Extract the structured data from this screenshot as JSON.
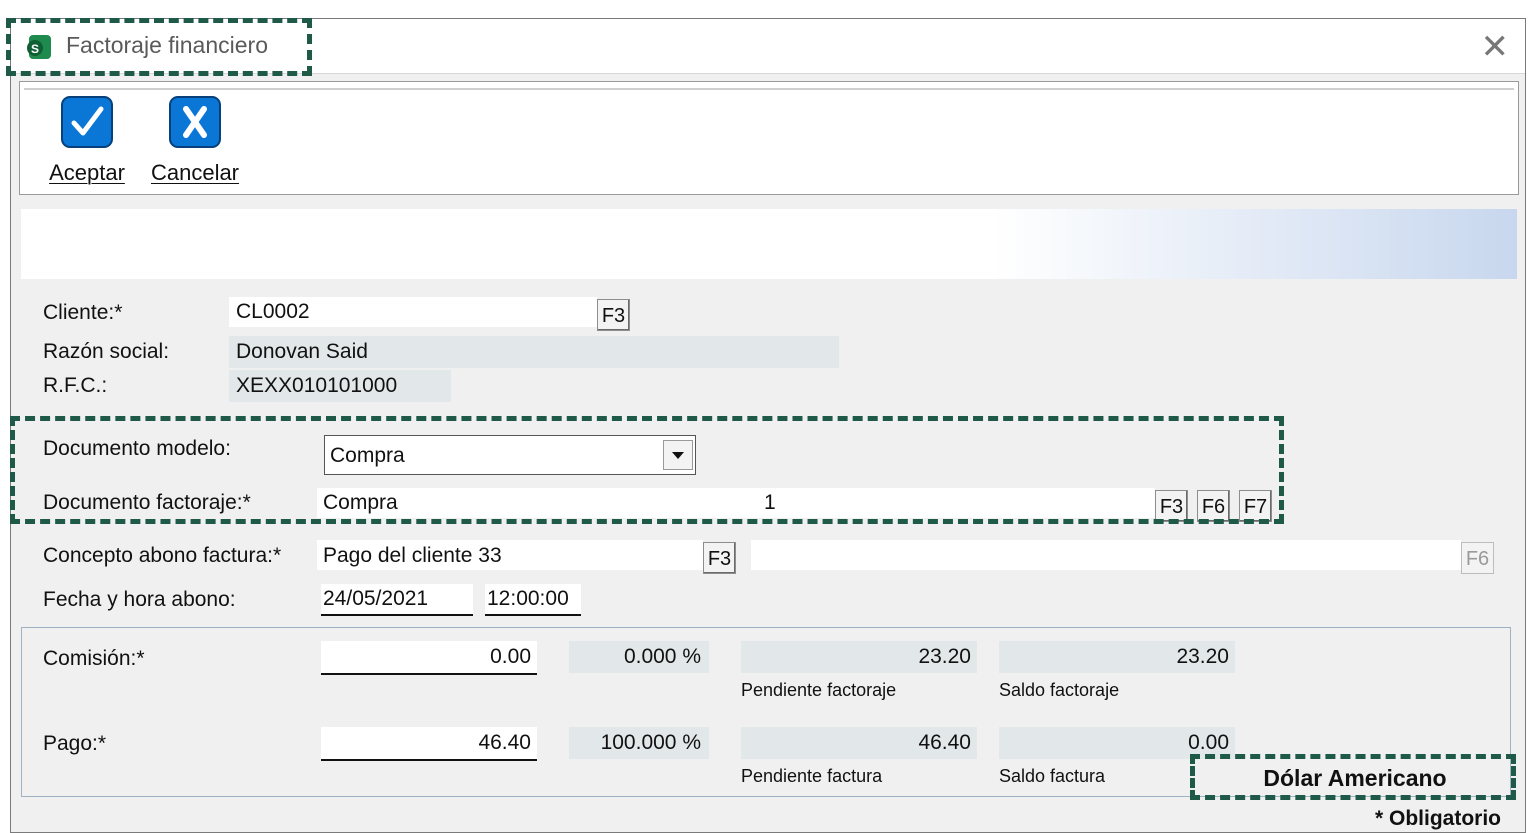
{
  "window": {
    "title": "Factoraje financiero"
  },
  "toolbar": {
    "accept_label": "Aceptar",
    "cancel_label": "Cancelar"
  },
  "form": {
    "cliente_label": "Cliente:*",
    "cliente_value": "CL0002",
    "razon_label": "Razón social:",
    "razon_value": "Donovan Said",
    "rfc_label": "R.F.C.:",
    "rfc_value": "XEXX010101000",
    "doc_modelo_label": "Documento modelo:",
    "doc_modelo_value": "Compra",
    "doc_factoraje_label": "Documento factoraje:*",
    "doc_factoraje_value": "Compra",
    "doc_factoraje_number": "1",
    "concepto_label": "Concepto abono factura:*",
    "concepto_value": "Pago del cliente 33",
    "fecha_label": "Fecha y hora abono:",
    "fecha_value": "24/05/2021",
    "hora_value": "12:00:00"
  },
  "buttons": {
    "f3": "F3",
    "f6": "F6",
    "f7": "F7"
  },
  "amounts": {
    "comision_label": "Comisión:*",
    "comision_value": "0.00",
    "comision_pct": "0.000 %",
    "pendiente_factoraje_value": "23.20",
    "pendiente_factoraje_label": "Pendiente factoraje",
    "saldo_factoraje_value": "23.20",
    "saldo_factoraje_label": "Saldo factoraje",
    "pago_label": "Pago:*",
    "pago_value": "46.40",
    "pago_pct": "100.000 %",
    "pendiente_factura_value": "46.40",
    "pendiente_factura_label": "Pendiente factura",
    "saldo_factura_value": "0.00",
    "saldo_factura_label": "Saldo factura",
    "currency": "Dólar Americano"
  },
  "footer": {
    "obligatorio": "* Obligatorio"
  },
  "colors": {
    "accent": "#0a76d6",
    "highlight_dash": "#1f5a48",
    "readonly_bg": "#e2e7e9"
  },
  "icons": {
    "app": "app-icon",
    "accept": "check-icon",
    "cancel": "x-icon",
    "close": "close-icon",
    "dropdown": "chevron-down-icon"
  }
}
